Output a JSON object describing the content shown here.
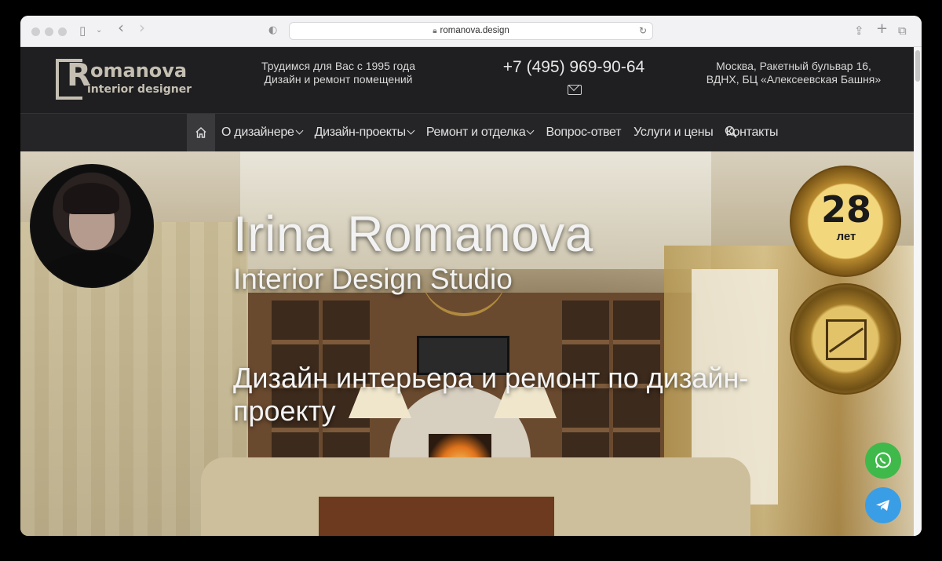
{
  "browser": {
    "url": "romanova.design"
  },
  "header": {
    "logo_name": "omanova",
    "logo_letter": "R",
    "logo_sub": "interior designer",
    "tagline_1": "Трудимся для Вас с 1995 года",
    "tagline_2": "Дизайн и ремонт помещений",
    "phone": "+7 (495) 969-90-64",
    "address_1": "Москва, Ракетный бульвар 16,",
    "address_2": "ВДНХ, БЦ «Алексеевская Башня»"
  },
  "nav": {
    "items": [
      {
        "label": "О дизайнере",
        "dropdown": true
      },
      {
        "label": "Дизайн-проекты",
        "dropdown": true
      },
      {
        "label": "Ремонт и отделка",
        "dropdown": true
      },
      {
        "label": "Вопрос-ответ",
        "dropdown": false
      },
      {
        "label": "Услуги и цены",
        "dropdown": false
      },
      {
        "label": "Контакты",
        "dropdown": false
      }
    ]
  },
  "hero": {
    "title": "Irina Romanova",
    "subtitle": "Interior Design Studio",
    "tagline": "Дизайн интерьера и ремонт по дизайн-проекту",
    "badge_years_number": "28",
    "badge_years_unit": "лет"
  },
  "icons": {
    "home": "home-icon",
    "search": "search-icon",
    "mail": "mail-icon",
    "whatsapp": "whatsapp-icon",
    "telegram": "telegram-icon"
  },
  "colors": {
    "header_bg": "#1f1f21",
    "nav_bg": "#252527",
    "whatsapp": "#3fb94a",
    "telegram": "#3a9ee6",
    "logo": "#c5bfb3"
  }
}
